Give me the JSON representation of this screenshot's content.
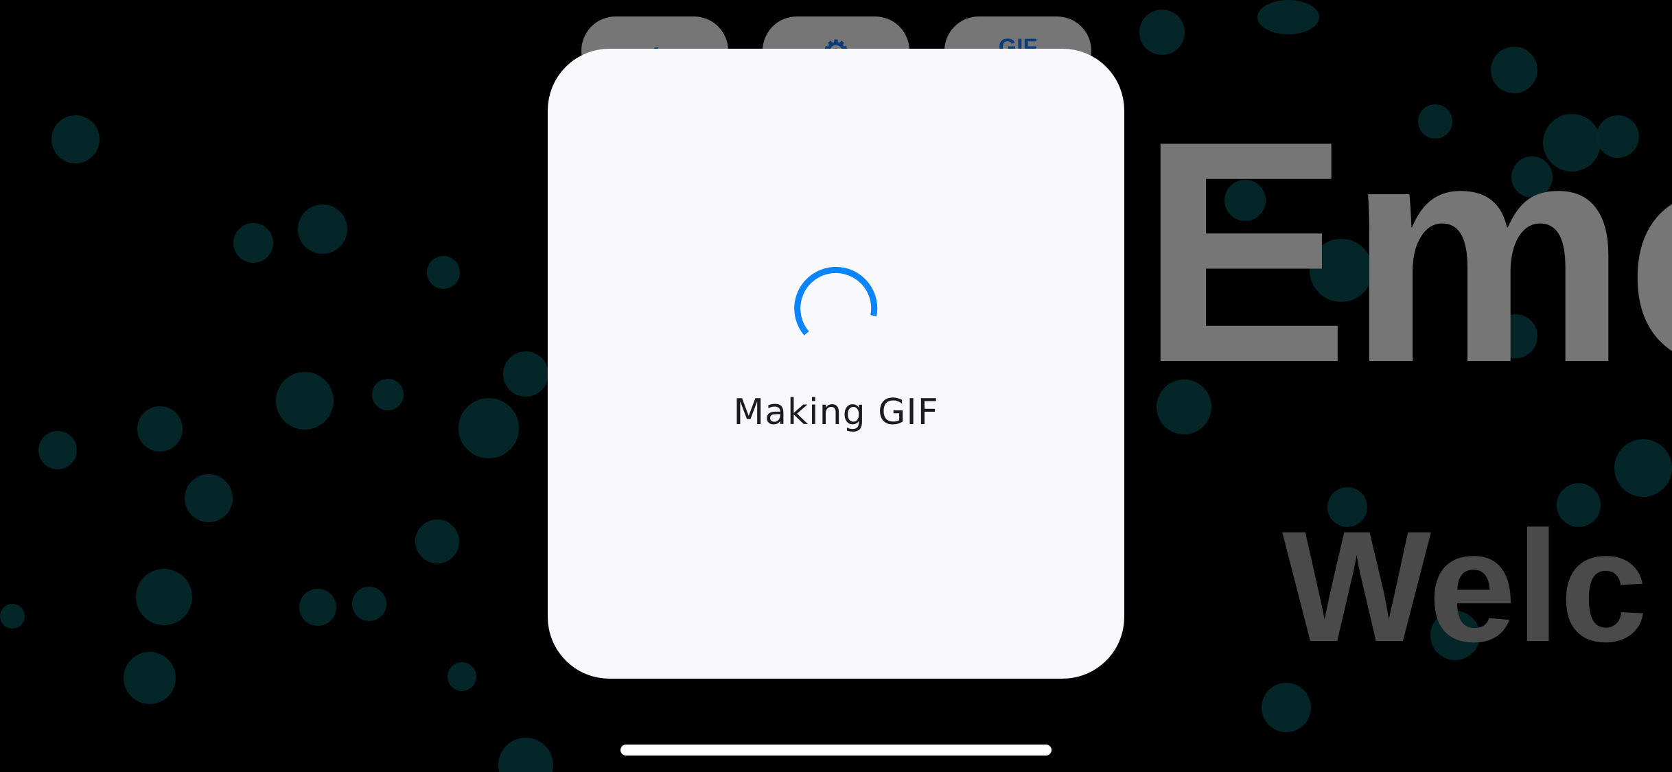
{
  "background": {
    "title": "Emo",
    "subtitle": "Welc",
    "color": "#000000",
    "bubble_color": "#042a2c"
  },
  "toolbar": {
    "back_icon": "chevron-left-icon",
    "settings_icon": "gear-icon",
    "gif_label": "GIF",
    "button_color": "#767676"
  },
  "hud": {
    "label": "Making GIF",
    "background": "#f8f8fd",
    "spinner_color": "#0a84ff",
    "spinner_icon": "activity-spinner-icon"
  }
}
